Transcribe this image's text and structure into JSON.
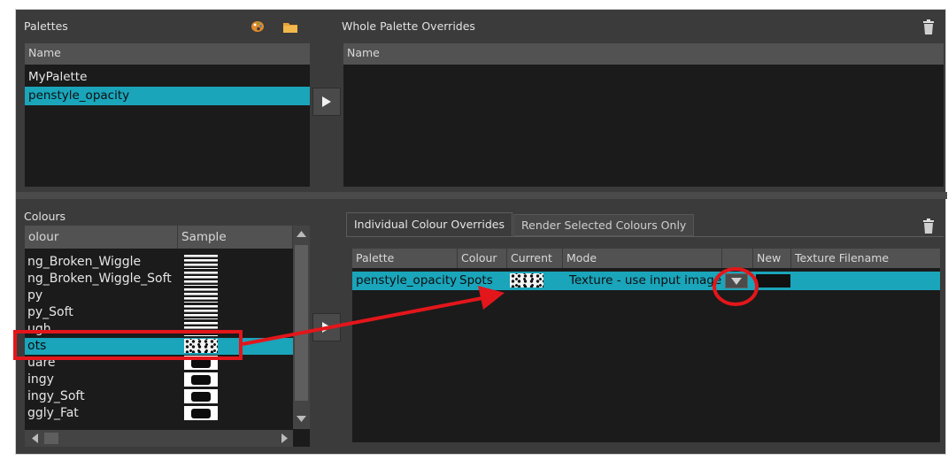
{
  "palettes": {
    "title": "Palettes",
    "column": "Name",
    "items": [
      "MyPalette",
      "penstyle_opacity"
    ],
    "selected_index": 1
  },
  "whole_overrides": {
    "title": "Whole Palette Overrides",
    "column": "Name"
  },
  "colours": {
    "title": "Colours",
    "col_name": "olour",
    "col_sample": "Sample",
    "items": [
      {
        "name": "ng_Broken_Wiggle",
        "sample": "stripes"
      },
      {
        "name": "ng_Broken_Wiggle_Soft",
        "sample": "stripes"
      },
      {
        "name": "py",
        "sample": "stripes"
      },
      {
        "name": "py_Soft",
        "sample": "stripes"
      },
      {
        "name": "ugh",
        "sample": "stripes"
      },
      {
        "name": "ots",
        "sample": "spots"
      },
      {
        "name": "uare",
        "sample": "block"
      },
      {
        "name": "ingy",
        "sample": "block"
      },
      {
        "name": "ingy_Soft",
        "sample": "block"
      },
      {
        "name": "ggly_Fat",
        "sample": "block"
      }
    ],
    "selected_index": 5
  },
  "tabs": {
    "individual": "Individual Colour Overrides",
    "render_selected": "Render Selected Colours Only"
  },
  "overrides_table": {
    "columns": [
      "Palette",
      "Colour",
      "Current",
      "Mode",
      "",
      "New",
      "Texture Filename"
    ],
    "row": {
      "palette": "penstyle_opacity",
      "colour": "Spots",
      "mode": "Texture - use input image"
    }
  },
  "annotation_color": "#e3161b",
  "accent": "#1aa5bb",
  "icons": [
    "palette-icon",
    "folder-icon",
    "trash-icon",
    "arrow-right-icon",
    "dropdown-arrow-icon"
  ]
}
